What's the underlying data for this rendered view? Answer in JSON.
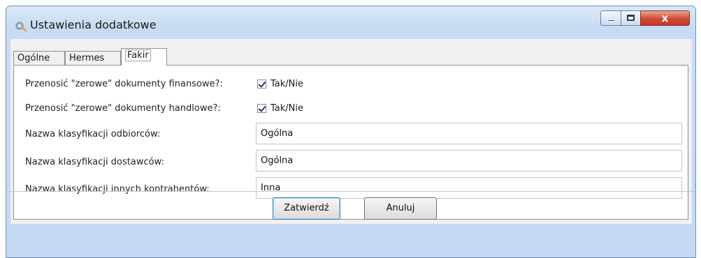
{
  "window": {
    "title": "Ustawienia dodatkowe",
    "close_glyph": "x",
    "icon": "settings-app-icon"
  },
  "tabs": [
    {
      "label": "Ogólne",
      "active": false
    },
    {
      "label": "Hermes",
      "active": false
    },
    {
      "label": "Fakir",
      "active": true
    }
  ],
  "form": {
    "finansowe": {
      "label": "Przenosić \"zerowe\" dokumenty finansowe?:",
      "checkbox_label": "Tak/Nie",
      "checked": true
    },
    "handlowe": {
      "label": "Przenosić \"zerowe\" dokumenty handlowe?:",
      "checkbox_label": "Tak/Nie",
      "checked": true
    },
    "odbiorcy": {
      "label": "Nazwa klasyfikacji odbiorców:",
      "value": "Ogólna"
    },
    "dostawcy": {
      "label": "Nazwa klasyfikacji dostawców:",
      "value": "Ogólna"
    },
    "inni": {
      "label": "Nazwa klasyfikacji innych kontrahentów:",
      "value": "Inna"
    }
  },
  "buttons": {
    "confirm": "Zatwierdź",
    "cancel": "Anuluj"
  },
  "colors": {
    "frame": "#c7dcf3",
    "close_button": "#c23a27",
    "panel": "#ffffff"
  }
}
